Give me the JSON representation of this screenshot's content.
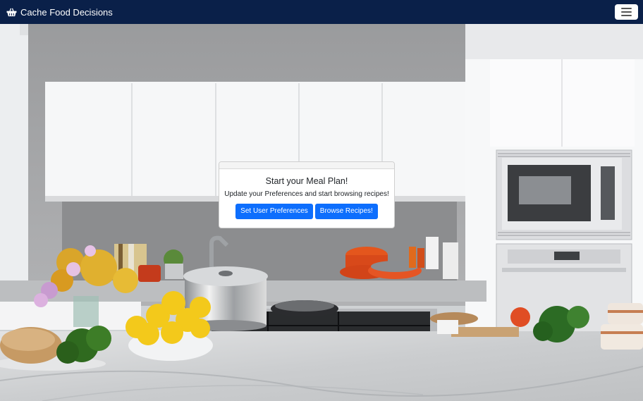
{
  "navbar": {
    "brand": "Cache Food Decisions",
    "brand_icon": "basket-icon",
    "menu_icon": "hamburger-menu-icon"
  },
  "hero": {
    "background": "kitchen photo"
  },
  "card": {
    "title": "Start your Meal Plan!",
    "text": "Update your Preferences and start browsing recipes!",
    "button_preferences": "Set User Preferences",
    "button_browse": "Browse Recipes!"
  },
  "colors": {
    "navbar": "#0a2049",
    "button": "#0d6efd"
  }
}
